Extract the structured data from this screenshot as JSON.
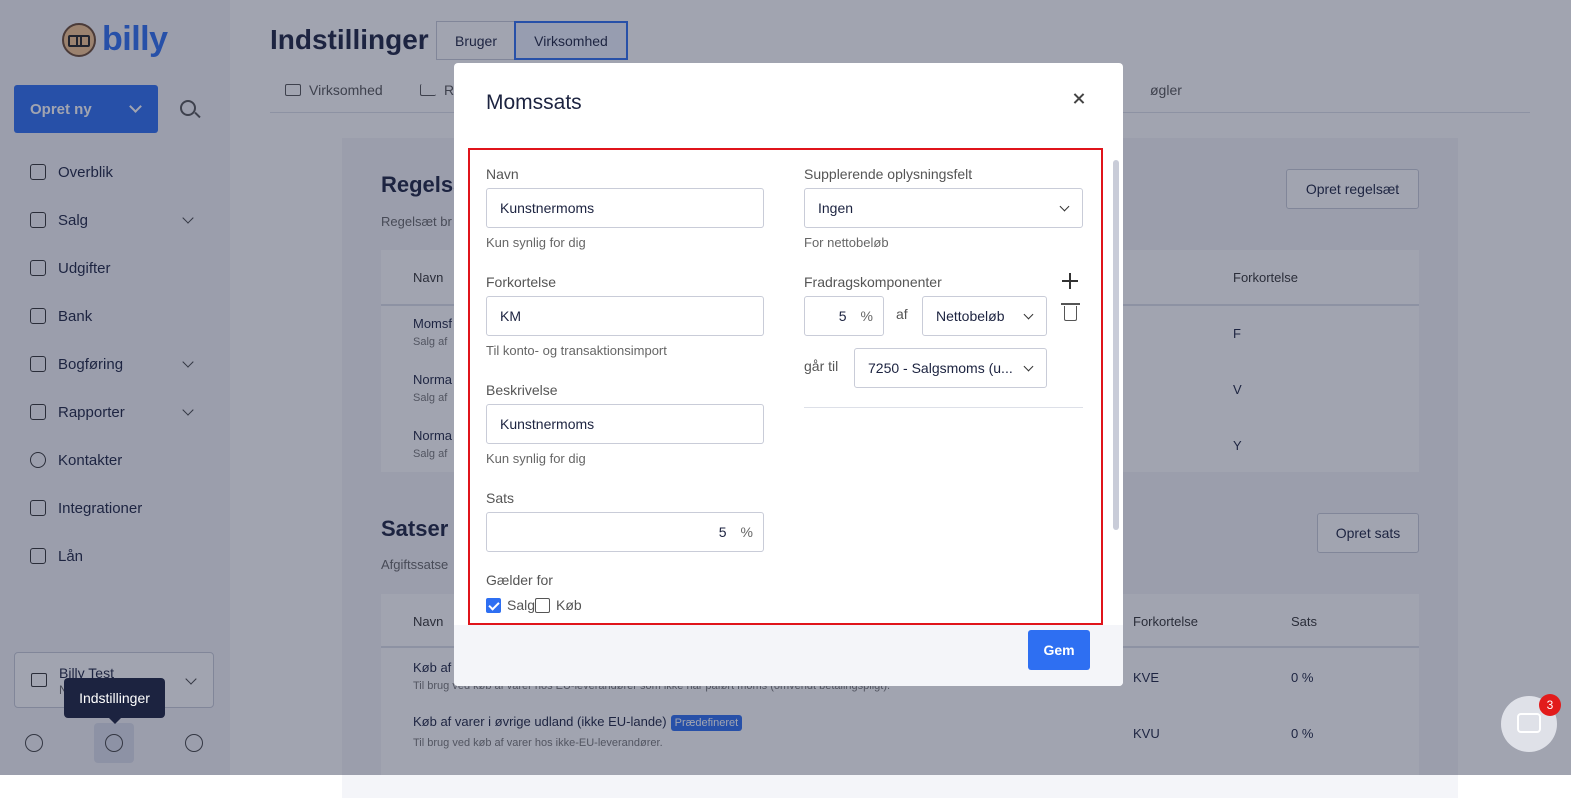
{
  "app": {
    "logo_text": "billy"
  },
  "sidebar": {
    "create_label": "Opret ny",
    "items": [
      {
        "label": "Overblik",
        "icon": "dashboard-icon"
      },
      {
        "label": "Salg",
        "icon": "wallet-icon"
      },
      {
        "label": "Udgifter",
        "icon": "receipt-icon"
      },
      {
        "label": "Bank",
        "icon": "bank-icon"
      },
      {
        "label": "Bogføring",
        "icon": "calculator-icon"
      },
      {
        "label": "Rapporter",
        "icon": "report-icon"
      },
      {
        "label": "Kontakter",
        "icon": "contacts-icon"
      },
      {
        "label": "Integrationer",
        "icon": "puzzle-icon"
      },
      {
        "label": "Lån",
        "icon": "moneybag-icon"
      }
    ],
    "org_name": "Billy Test",
    "org_sub": "N",
    "tooltip": "Indstillinger"
  },
  "header": {
    "title": "Indstillinger",
    "seg_user": "Bruger",
    "seg_company": "Virksomhed",
    "subtab_company": "Virksomhed",
    "subtab_reports": "Re",
    "subtab_keys": "øgler"
  },
  "background": {
    "rules_title": "Regelsæ",
    "rules_sub": "Regelsæt br",
    "create_rule_btn": "Opret regelsæt",
    "col_name": "Navn",
    "col_abbr": "Forkortelse",
    "rules_rows": [
      {
        "name": "Momsf",
        "sub": "Salg af",
        "abbr": "F"
      },
      {
        "name": "Norma",
        "sub": "Salg af",
        "abbr": "V"
      },
      {
        "name": "Norma",
        "sub": "Salg af",
        "abbr": "Y"
      }
    ],
    "rates_title": "Satser",
    "rates_sub": "Afgiftssatse",
    "create_rate_btn": "Opret sats",
    "col_rate": "Sats",
    "rates_rows": [
      {
        "name": "Køb af",
        "sub": "Til brug ved køb af varer hos EU-leverandører som ikke har påført moms (omvendt betalingspligt).",
        "abbr": "KVE",
        "rate": "0 %"
      },
      {
        "name": "Køb af varer i øvrige udland (ikke EU-lande)",
        "badge": "Prædefineret",
        "sub": "Til brug ved køb af varer hos ikke-EU-leverandører.",
        "abbr": "KVU",
        "rate": "0 %"
      }
    ]
  },
  "modal": {
    "title": "Momssats",
    "name_label": "Navn",
    "name_value": "Kunstnermoms",
    "name_hint": "Kun synlig for dig",
    "abbr_label": "Forkortelse",
    "abbr_value": "KM",
    "abbr_hint": "Til konto- og transaktionsimport",
    "desc_label": "Beskrivelse",
    "desc_value": "Kunstnermoms",
    "desc_hint": "Kun synlig for dig",
    "rate_label": "Sats",
    "rate_value": "5",
    "pct": "%",
    "applies_label": "Gælder for",
    "applies_sales": "Salg",
    "applies_sales_checked": true,
    "applies_purchase": "Køb",
    "applies_purchase_checked": false,
    "extra_label": "Supplerende oplysningsfelt",
    "extra_value": "Ingen",
    "extra_hint": "For nettobeløb",
    "deduct_label": "Fradragskomponenter",
    "deduct_rate": "5",
    "deduct_of": "af",
    "deduct_base": "Nettobeløb",
    "goes_to_label": "går til",
    "goes_to_value": "7250 - Salgsmoms (u...",
    "save_label": "Gem"
  },
  "chat": {
    "badge": "3"
  },
  "colors": {
    "accent": "#2e6ff2",
    "highlight_border": "#e0141b"
  }
}
